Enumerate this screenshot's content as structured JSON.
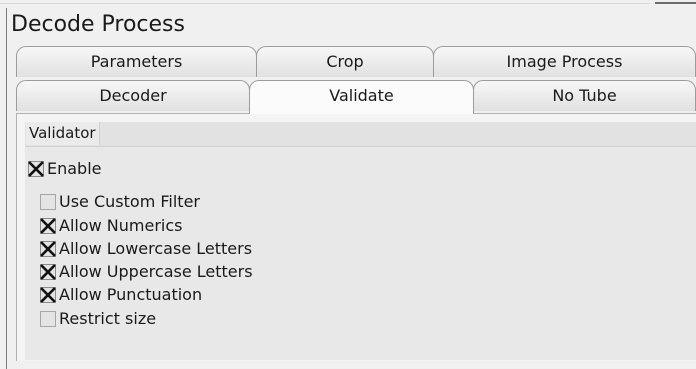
{
  "panel": {
    "title": "Decode Process"
  },
  "tabs": {
    "row1": [
      "Parameters",
      "Crop",
      "Image Process"
    ],
    "row2": [
      "Decoder",
      "Validate",
      "No Tube"
    ],
    "active": "Validate"
  },
  "validator": {
    "group_title": "Validator",
    "enable": {
      "label": "Enable",
      "checked": true
    },
    "options": [
      {
        "label": "Use Custom Filter",
        "checked": false
      },
      {
        "label": "Allow Numerics",
        "checked": true
      },
      {
        "label": "Allow Lowercase Letters",
        "checked": true
      },
      {
        "label": "Allow Uppercase Letters",
        "checked": true
      },
      {
        "label": "Allow Punctuation",
        "checked": true
      },
      {
        "label": "Restrict size",
        "checked": false
      }
    ]
  },
  "icons": {
    "checked": "checkbox-checked-x-icon",
    "unchecked": "checkbox-unchecked-icon"
  }
}
